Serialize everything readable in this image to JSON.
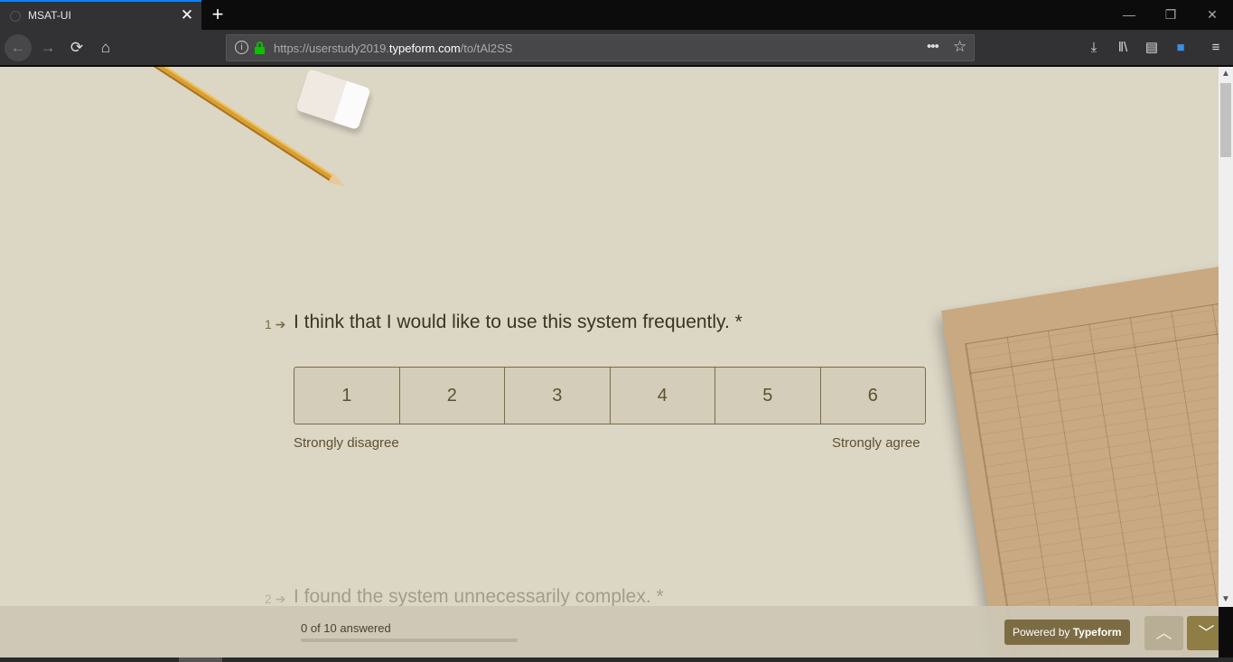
{
  "browser": {
    "tab_title": "MSAT-UI",
    "tab_close": "✕",
    "new_tab": "+",
    "url_prefix": "https://userstudy2019.",
    "url_domain": "typeform.com",
    "url_path": "/to/tAl2SS",
    "window_controls": [
      "—",
      "❐",
      "✕"
    ]
  },
  "form": {
    "questions": [
      {
        "number": "1",
        "text": "I think that I would like to use this system frequently. *"
      },
      {
        "number": "2",
        "text": "I found the system unnecessarily complex. *"
      }
    ],
    "scale_options": [
      "1",
      "2",
      "3",
      "4",
      "5",
      "6"
    ],
    "scale_left_label": "Strongly disagree",
    "scale_right_label": "Strongly agree"
  },
  "footer": {
    "progress_text": "0 of 10 answered",
    "progress_fraction": 0,
    "powered_prefix": "Powered by ",
    "powered_brand": "Typeform"
  },
  "colors": {
    "page_bg": "#dcd6c5",
    "accent": "#7b6c44",
    "text": "#3b3323"
  }
}
